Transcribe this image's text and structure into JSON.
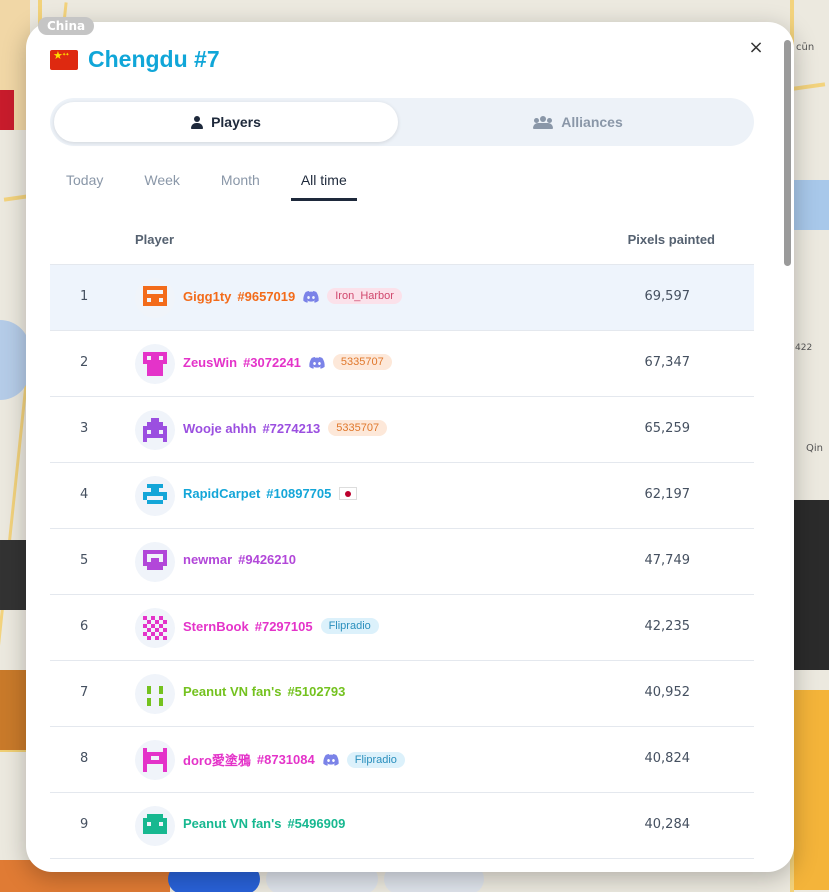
{
  "country_tag": "China",
  "title": "Chengdu #7",
  "close_icon": "×",
  "segments": [
    {
      "label": "Players",
      "icon": "user-icon",
      "active": true
    },
    {
      "label": "Alliances",
      "icon": "users-icon",
      "active": false
    }
  ],
  "tabs": [
    {
      "label": "Today",
      "active": false
    },
    {
      "label": "Week",
      "active": false
    },
    {
      "label": "Month",
      "active": false
    },
    {
      "label": "All time",
      "active": true
    }
  ],
  "table": {
    "col_player": "Player",
    "col_pixels": "Pixels painted",
    "rows": [
      {
        "rank": "1",
        "name": "Gigg1ty",
        "id": "#9657019",
        "color": "#f36b1a",
        "discord": true,
        "badge": "Iron_Harbor",
        "badge_bg": "#fbe1ea",
        "badge_color": "#d0476d",
        "flag": "",
        "pixels": "69,597",
        "highlight": true
      },
      {
        "rank": "2",
        "name": "ZeusWin",
        "id": "#3072241",
        "color": "#e433c9",
        "discord": true,
        "badge": "5335707",
        "badge_bg": "#fde8d9",
        "badge_color": "#e0782c",
        "flag": "",
        "pixels": "67,347",
        "highlight": false
      },
      {
        "rank": "3",
        "name": "Wooje ahhh",
        "id": "#7274213",
        "color": "#9b4fe0",
        "discord": false,
        "badge": "5335707",
        "badge_bg": "#fde8d9",
        "badge_color": "#e0782c",
        "flag": "",
        "pixels": "65,259",
        "highlight": false
      },
      {
        "rank": "4",
        "name": "RapidCarpet",
        "id": "#10897705",
        "color": "#14a6d8",
        "discord": false,
        "badge": "",
        "badge_bg": "",
        "badge_color": "",
        "flag": "jp",
        "pixels": "62,197",
        "highlight": false
      },
      {
        "rank": "5",
        "name": "newmar",
        "id": "#9426210",
        "color": "#b247d9",
        "discord": false,
        "badge": "",
        "badge_bg": "",
        "badge_color": "",
        "flag": "",
        "pixels": "47,749",
        "highlight": false
      },
      {
        "rank": "6",
        "name": "SternBook",
        "id": "#7297105",
        "color": "#e433c9",
        "discord": false,
        "badge": "Flipradio",
        "badge_bg": "#dcf1fb",
        "badge_color": "#2a8fbd",
        "flag": "",
        "pixels": "42,235",
        "highlight": false
      },
      {
        "rank": "7",
        "name": "Peanut VN fan's",
        "id": "#5102793",
        "color": "#74c21f",
        "discord": false,
        "badge": "",
        "badge_bg": "",
        "badge_color": "",
        "flag": "",
        "pixels": "40,952",
        "highlight": false
      },
      {
        "rank": "8",
        "name": "doro愛塗鴉",
        "id": "#8731084",
        "color": "#e433c9",
        "discord": true,
        "badge": "Flipradio",
        "badge_bg": "#dcf1fb",
        "badge_color": "#2a8fbd",
        "flag": "",
        "pixels": "40,824",
        "highlight": false
      },
      {
        "rank": "9",
        "name": "Peanut VN fan's",
        "id": "#5496909",
        "color": "#17b890",
        "discord": false,
        "badge": "",
        "badge_bg": "",
        "badge_color": "",
        "flag": "",
        "pixels": "40,284",
        "highlight": false
      }
    ]
  },
  "map_labels": {
    "a": "cūn",
    "b": "422",
    "c": "Qin"
  }
}
